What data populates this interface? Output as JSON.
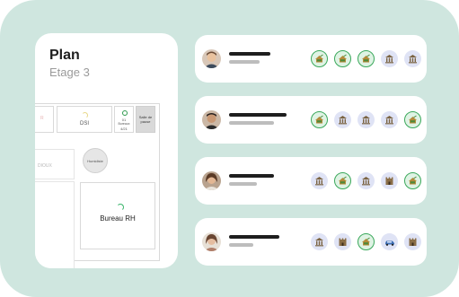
{
  "plan": {
    "title": "Plan",
    "subtitle": "Etage 3",
    "rooms": {
      "dsi": "DSI",
      "small_title": "01",
      "small_mid": "Bureaux",
      "small_bot": "4/21",
      "grey": "Salle de pause",
      "left": "R",
      "corridor": "DIOUX",
      "circle": "Humidiste",
      "rh": "Bureau RH"
    }
  },
  "rows": [
    {
      "icons": [
        "check",
        "check",
        "check",
        "building",
        "building"
      ]
    },
    {
      "icons": [
        "check",
        "building",
        "building",
        "building",
        "check"
      ]
    },
    {
      "icons": [
        "building",
        "check",
        "building",
        "castle",
        "check"
      ]
    },
    {
      "icons": [
        "building",
        "castle",
        "check",
        "car",
        "castle"
      ]
    }
  ],
  "colors": {
    "background": "#cfe6df",
    "check_border": "#3aa85b",
    "icon_bg": "#dfe3f5"
  }
}
